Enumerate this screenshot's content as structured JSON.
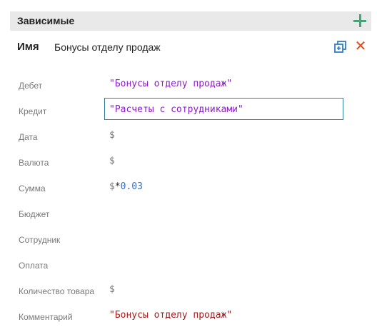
{
  "section": {
    "title": "Зависимые",
    "add_icon": "plus-icon",
    "accent": "#4aa37a"
  },
  "item": {
    "name_label": "Имя",
    "name_value": "Бонусы отделу продаж",
    "copy_icon": "duplicate-icon",
    "close_icon": "close-icon",
    "close_color": "#e24a1f"
  },
  "fields": [
    {
      "label": "Дебет",
      "value": "\"Бонусы отделу продаж\""
    },
    {
      "label": "Кредит",
      "value": "\"Расчеты с сотрудниками\""
    },
    {
      "label": "Дата",
      "value": "$"
    },
    {
      "label": "Валюта",
      "value": "$"
    },
    {
      "label": "Сумма",
      "value_dollar": "$",
      "value_op": "*",
      "value_num": "0.03"
    },
    {
      "label": "Бюджет",
      "value": ""
    },
    {
      "label": "Сотрудник",
      "value": ""
    },
    {
      "label": "Оплата",
      "value": ""
    },
    {
      "label": "Количество товара",
      "value": "$"
    },
    {
      "label": "Комментарий",
      "value": "\"Бонусы отделу продаж\""
    }
  ]
}
